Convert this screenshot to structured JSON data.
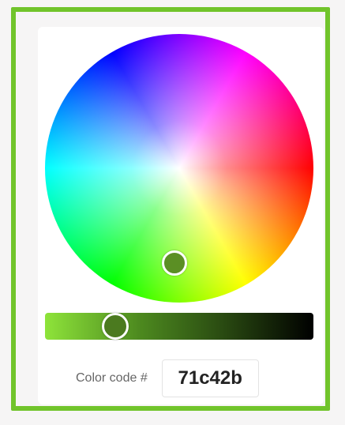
{
  "picker": {
    "hue_handle_color": "#5b8f24",
    "brightness_handle_color": "#4b7a1f",
    "accent": "#71c42b"
  },
  "slider": {
    "start_color": "#8ee43a",
    "end_color": "#000000"
  },
  "color_code": {
    "label": "Color code #",
    "value": "71c42b"
  }
}
